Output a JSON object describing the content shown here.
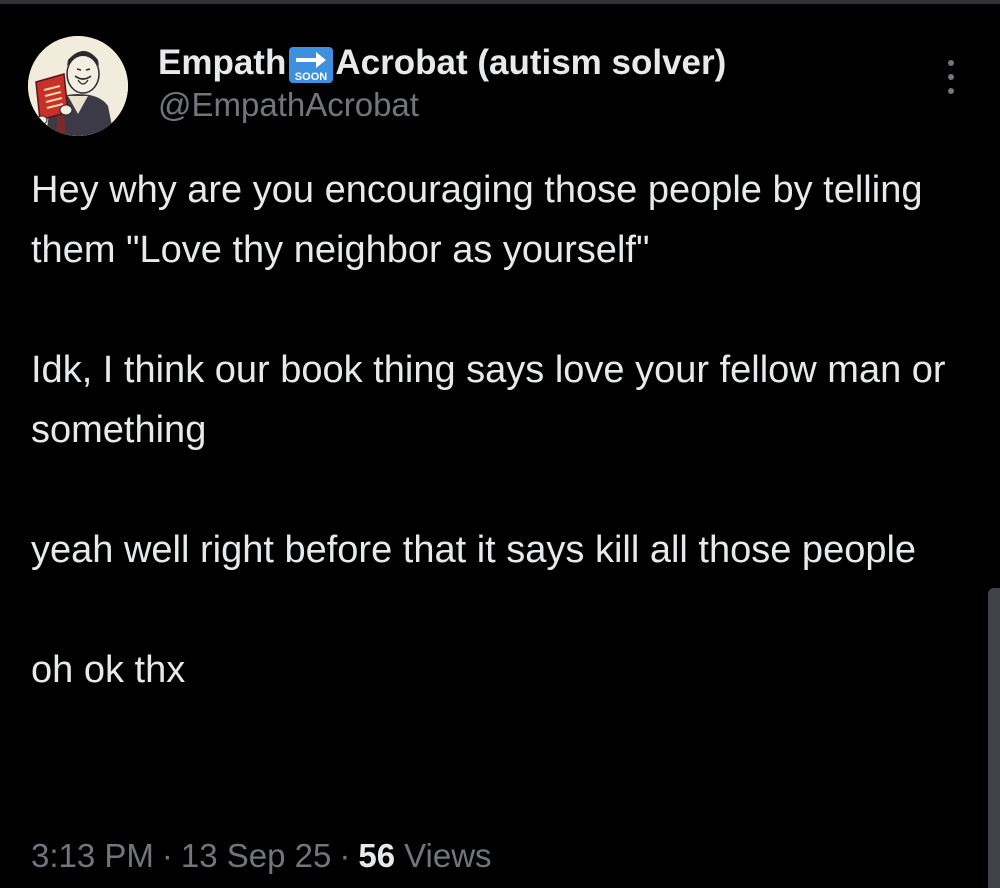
{
  "author": {
    "name_part1": "Empath",
    "emoji_label": "SOON",
    "name_part2": "Acrobat (autism solver)",
    "handle": "@EmpathAcrobat"
  },
  "tweet": {
    "paragraphs": [
      "Hey why are you encouraging those people by telling them \"Love thy neighbor as yourself\"",
      "Idk, I think our book thing says love your fellow man or something",
      "yeah well right before that it says kill all those people",
      "oh ok thx"
    ]
  },
  "meta": {
    "time": "3:13 PM",
    "separator": "·",
    "date": "13 Sep 25",
    "views_count": "56",
    "views_label": "Views"
  },
  "icons": {
    "more": "more-vertical-icon",
    "emoji": "soon-arrow-emoji-icon"
  },
  "colors": {
    "background": "#000000",
    "text_primary": "#e7e9ea",
    "text_secondary": "#71767b",
    "emoji_blue": "#3d8fe0"
  }
}
